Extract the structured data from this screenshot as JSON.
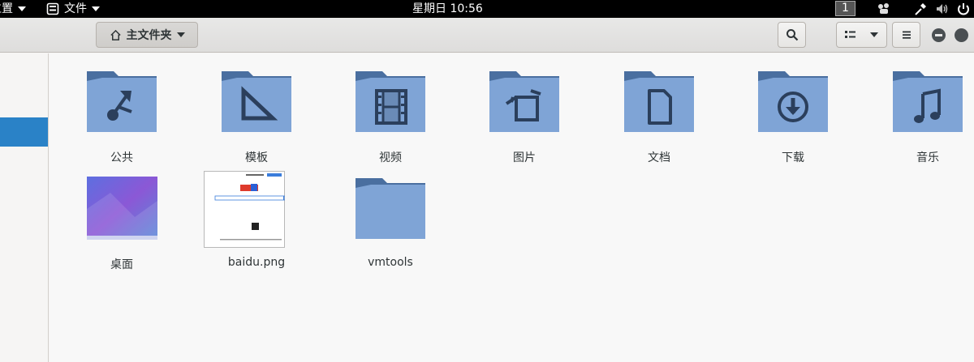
{
  "topbar": {
    "menu1_label": "位置",
    "menu2_label": "文件",
    "clock": "星期日 10:56",
    "workspace": "1"
  },
  "header": {
    "path_label": "主文件夹"
  },
  "items": [
    {
      "label": "公共",
      "icon": "share-folder-icon"
    },
    {
      "label": "模板",
      "icon": "templates-folder-icon"
    },
    {
      "label": "视频",
      "icon": "videos-folder-icon"
    },
    {
      "label": "图片",
      "icon": "pictures-folder-icon"
    },
    {
      "label": "文档",
      "icon": "documents-folder-icon"
    },
    {
      "label": "下载",
      "icon": "downloads-folder-icon"
    },
    {
      "label": "音乐",
      "icon": "music-folder-icon"
    },
    {
      "label": "桌面",
      "icon": "desktop-folder-icon"
    },
    {
      "label": "baidu.png",
      "icon": "image-thumbnail"
    },
    {
      "label": "vmtools",
      "icon": "folder-icon"
    }
  ],
  "colors": {
    "folder_back": "#4a6fa0",
    "folder_front": "#7fa4d6",
    "folder_glyph": "#2b3f5c",
    "selection": "#2a82c7"
  }
}
